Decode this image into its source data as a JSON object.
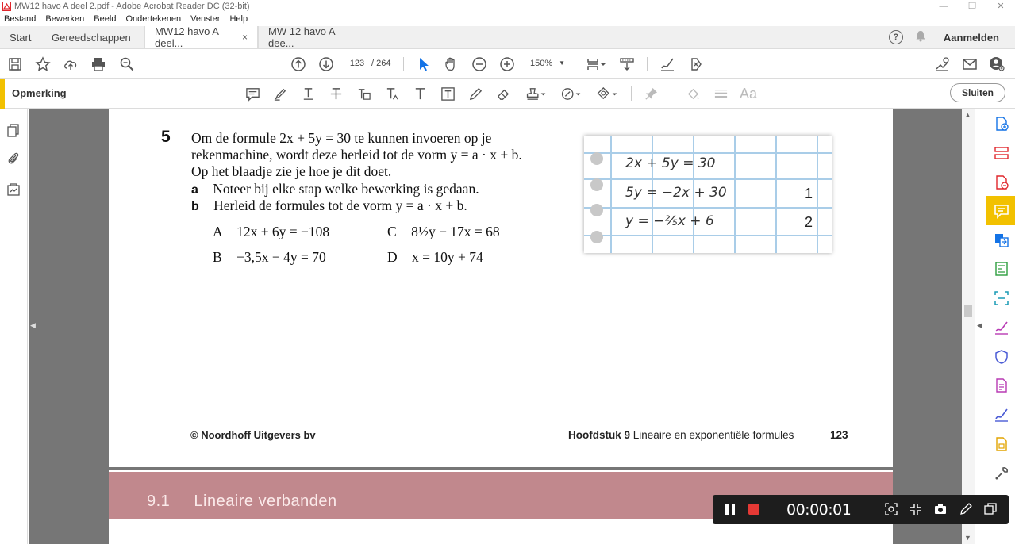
{
  "window": {
    "title": "MW12 havo A deel 2.pdf - Adobe Acrobat Reader DC (32-bit)",
    "controls": [
      "—",
      "❐",
      "✕"
    ]
  },
  "menu": [
    "Bestand",
    "Bewerken",
    "Beeld",
    "Ondertekenen",
    "Venster",
    "Help"
  ],
  "tabs": {
    "home": "Start",
    "tools": "Gereedschappen",
    "doc1": "MW12 havo A deel...",
    "doc1_close": "×",
    "doc2": "MW 12 havo A dee...",
    "signin": "Aanmelden",
    "help_glyph": "?"
  },
  "toolbar": {
    "page_current": "123",
    "page_total": "/  264",
    "zoom": "150%"
  },
  "comment_toolbar": {
    "label": "Opmerking",
    "close_label": "Sluiten",
    "text_tool": "Aa"
  },
  "document": {
    "exercise_number": "5",
    "intro_lines": [
      "Om de formule 2x + 5y = 30 te kunnen invoeren op je",
      "rekenmachine, wordt deze herleid tot de vorm y = a · x + b.",
      "Op het blaadje zie je hoe je dit doet."
    ],
    "sub_a_label": "a",
    "sub_a_text": "Noteer bij elke stap welke bewerking is gedaan.",
    "sub_b_label": "b",
    "sub_b_text": "Herleid de formules tot de vorm y = a · x + b.",
    "formulas": [
      {
        "label": "A",
        "text": "12x + 6y = −108"
      },
      {
        "label": "C",
        "text": "8½y − 17x = 68"
      },
      {
        "label": "B",
        "text": "−3,5x − 4y = 70"
      },
      {
        "label": "D",
        "text": "x = 10y + 74"
      }
    ],
    "notebook": {
      "lines": [
        "2x + 5y = 30",
        "5y = −2x + 30",
        "y = −⅖x + 6"
      ],
      "steps": [
        "1",
        "2"
      ]
    },
    "footer_publisher": "© Noordhoff Uitgevers bv",
    "footer_chapter_bold": "Hoofdstuk 9",
    "footer_chapter_title": "Lineaire en exponentiële formules",
    "footer_page": "123",
    "next_section_number": "9.1",
    "next_section_title": "Lineaire verbanden"
  },
  "recorder": {
    "time": "00:00:01"
  },
  "colors": {
    "accent_yellow": "#f2c100",
    "acrobat_red": "#e0262c",
    "section_band": "#c1888d",
    "notebook_grid": "#a9cde8",
    "record_red": "#e53935"
  }
}
